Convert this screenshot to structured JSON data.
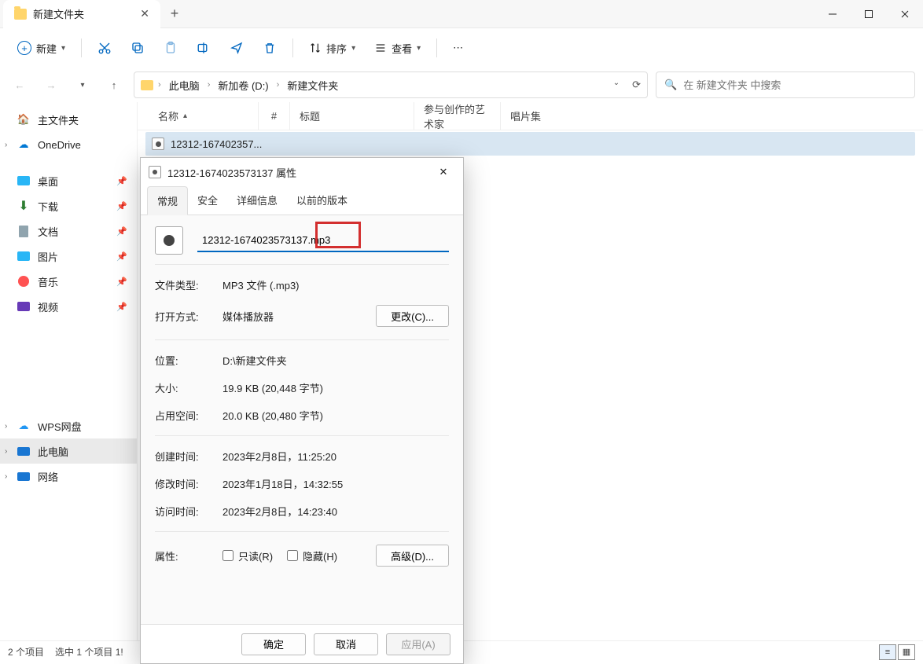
{
  "titlebar": {
    "tab_title": "新建文件夹"
  },
  "toolbar": {
    "new_label": "新建",
    "sort_label": "排序",
    "view_label": "查看"
  },
  "breadcrumb": {
    "items": [
      "此电脑",
      "新加卷 (D:)",
      "新建文件夹"
    ]
  },
  "search": {
    "placeholder": "在 新建文件夹 中搜索"
  },
  "sidebar": {
    "home": "主文件夹",
    "onedrive": "OneDrive",
    "desktop": "桌面",
    "downloads": "下载",
    "documents": "文档",
    "pictures": "图片",
    "music": "音乐",
    "videos": "视频",
    "wps": "WPS网盘",
    "thispc": "此电脑",
    "network": "网络"
  },
  "columns": {
    "name": "名称",
    "num": "#",
    "title": "标题",
    "artist": "参与创作的艺术家",
    "album": "唱片集"
  },
  "file": {
    "name_truncated": "12312-167402357..."
  },
  "status": {
    "count": "2 个项目",
    "selected": "选中 1 个项目  1!"
  },
  "dialog": {
    "title": "12312-1674023573137 属性",
    "tabs": {
      "general": "常规",
      "security": "安全",
      "details": "详细信息",
      "previous": "以前的版本"
    },
    "filename": "12312-1674023573137.mp3",
    "rows": {
      "filetype_lbl": "文件类型:",
      "filetype_val": "MP3 文件 (.mp3)",
      "openwith_lbl": "打开方式:",
      "openwith_val": "媒体播放器",
      "change_btn": "更改(C)...",
      "location_lbl": "位置:",
      "location_val": "D:\\新建文件夹",
      "size_lbl": "大小:",
      "size_val": "19.9 KB (20,448 字节)",
      "ondisk_lbl": "占用空间:",
      "ondisk_val": "20.0 KB (20,480 字节)",
      "created_lbl": "创建时间:",
      "created_val": "2023年2月8日，11:25:20",
      "modified_lbl": "修改时间:",
      "modified_val": "2023年1月18日，14:32:55",
      "accessed_lbl": "访问时间:",
      "accessed_val": "2023年2月8日，14:23:40",
      "attr_lbl": "属性:",
      "readonly": "只读(R)",
      "hidden": "隐藏(H)",
      "advanced_btn": "高级(D)..."
    },
    "footer": {
      "ok": "确定",
      "cancel": "取消",
      "apply": "应用(A)"
    }
  }
}
